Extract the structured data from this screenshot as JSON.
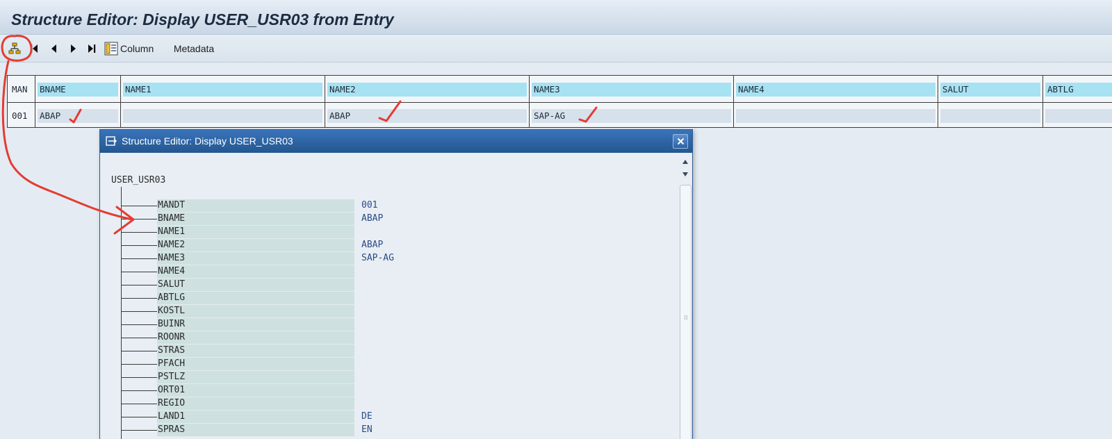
{
  "window": {
    "title": "Structure Editor: Display USER_USR03 from Entry"
  },
  "toolbar": {
    "items": [
      {
        "name": "hierarchy-view",
        "icon": "hierarchy-icon"
      },
      {
        "name": "first-entry",
        "icon": "first-page-icon"
      },
      {
        "name": "previous-entry",
        "icon": "previous-icon"
      },
      {
        "name": "next-entry",
        "icon": "next-icon"
      },
      {
        "name": "last-entry",
        "icon": "last-page-icon"
      }
    ],
    "column_label": "Column",
    "column_icon": "column-settings-icon",
    "metadata_label": "Metadata"
  },
  "grid": {
    "columns": [
      "MAN",
      "BNAME",
      "NAME1",
      "NAME2",
      "NAME3",
      "NAME4",
      "SALUT",
      "ABTLG"
    ],
    "row": [
      "001",
      "ABAP",
      "",
      "ABAP",
      "SAP-AG",
      "",
      "",
      ""
    ]
  },
  "dialog": {
    "title": "Structure Editor: Display USER_USR03",
    "root": "USER_USR03",
    "fields": [
      {
        "name": "MANDT",
        "value": "001"
      },
      {
        "name": "BNAME",
        "value": "ABAP"
      },
      {
        "name": "NAME1",
        "value": ""
      },
      {
        "name": "NAME2",
        "value": "ABAP"
      },
      {
        "name": "NAME3",
        "value": "SAP-AG"
      },
      {
        "name": "NAME4",
        "value": ""
      },
      {
        "name": "SALUT",
        "value": ""
      },
      {
        "name": "ABTLG",
        "value": ""
      },
      {
        "name": "KOSTL",
        "value": ""
      },
      {
        "name": "BUINR",
        "value": ""
      },
      {
        "name": "ROONR",
        "value": ""
      },
      {
        "name": "STRAS",
        "value": ""
      },
      {
        "name": "PFACH",
        "value": ""
      },
      {
        "name": "PSTLZ",
        "value": ""
      },
      {
        "name": "ORT01",
        "value": ""
      },
      {
        "name": "REGIO",
        "value": ""
      },
      {
        "name": "LAND1",
        "value": "DE"
      },
      {
        "name": "SPRAS",
        "value": "EN"
      }
    ]
  },
  "colors": {
    "header_cell": "#a7e2f2",
    "field_cell": "#cee0e0",
    "value_text": "#2c4a86",
    "dialog_title": "#2a5f9e",
    "annotation": "#e53b32"
  }
}
